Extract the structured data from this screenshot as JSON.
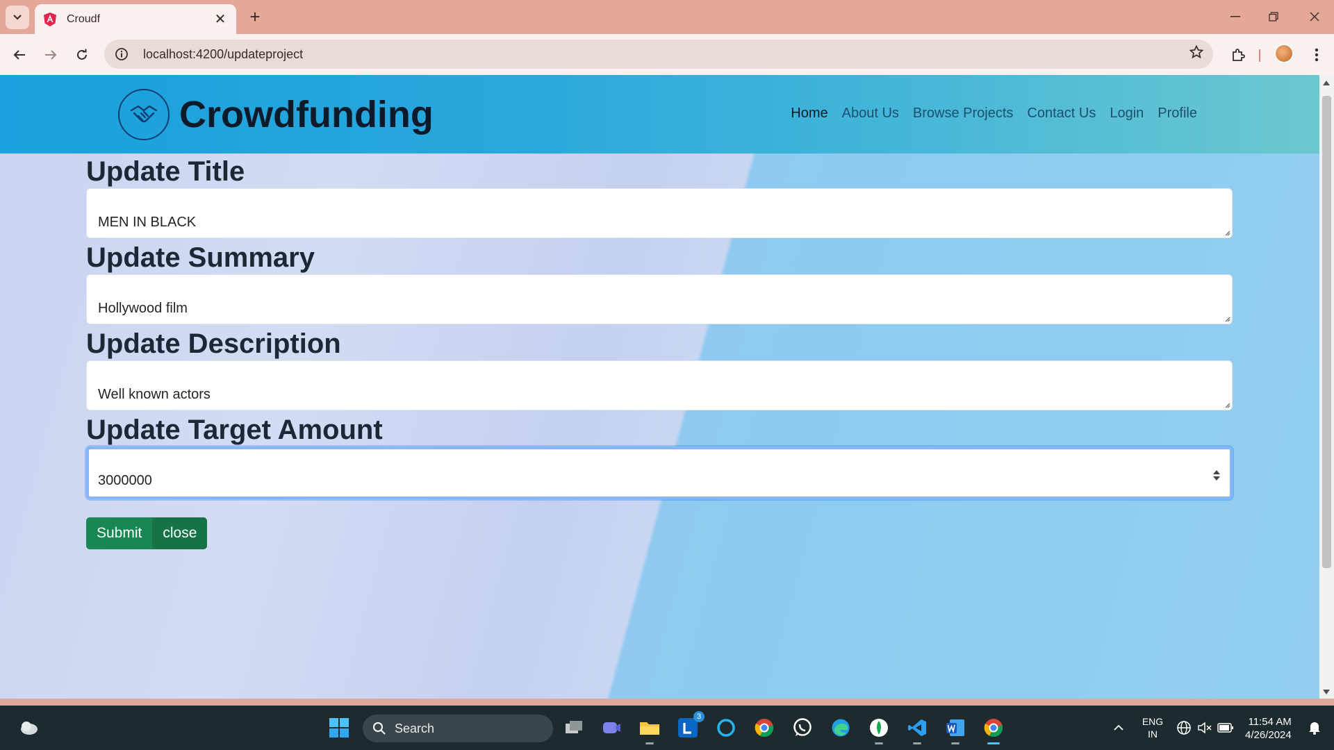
{
  "browser": {
    "tab_title": "Croudf",
    "url": "localhost:4200/updateproject",
    "new_tab": "+",
    "close_tab": "✕"
  },
  "site": {
    "brand": "Crowdfunding",
    "nav": [
      "Home",
      "About Us",
      "Browse Projects",
      "Contact Us",
      "Login",
      "Profile"
    ],
    "active_nav": "Home"
  },
  "form": {
    "title_label": "Update Title",
    "title_value": "MEN IN BLACK",
    "summary_label": "Update Summary",
    "summary_value": "Hollywood film",
    "description_label": "Update Description",
    "description_value": "Well known actors",
    "target_label": "Update Target Amount",
    "target_value": "3000000",
    "submit_label": "Submit",
    "close_label": "close"
  },
  "taskbar": {
    "search_label": "Search",
    "lang_line1": "ENG",
    "lang_line2": "IN",
    "time": "11:54 AM",
    "date": "4/26/2024",
    "badge_count": "3"
  },
  "colors": {
    "header_start": "#1aa0dc",
    "header_end": "#6cc8cf",
    "button": "#198754",
    "focus_ring": "#86b7fe"
  }
}
